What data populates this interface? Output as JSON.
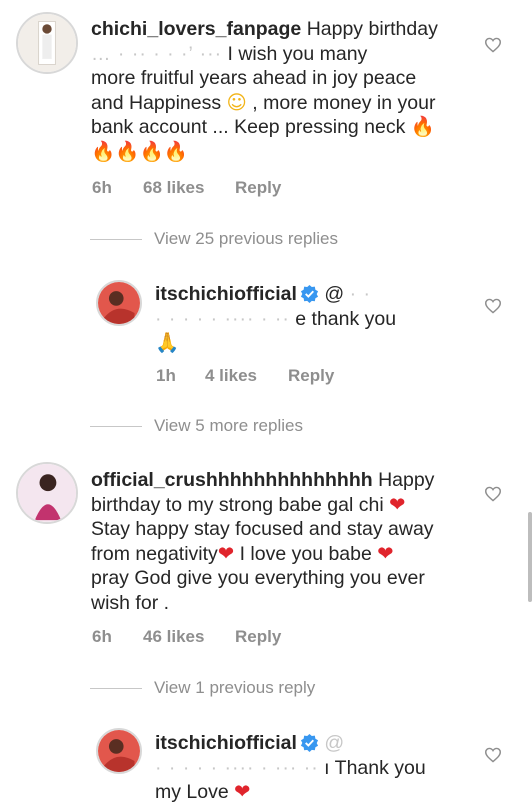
{
  "comments": [
    {
      "username": "chichi_lovers_fanpage",
      "line1_text": "Happy birthday",
      "line2_blur": "… · ··  · · ·’ ···",
      "line2_text": "I wish you many",
      "line3": "more fruitful years ahead in joy peace",
      "line4_text": "and Happiness",
      "line4_emoji": "☺",
      "line4_rest": ", more money in your",
      "line5_text": "bank account ... Keep pressing neck",
      "fire_emoji": "🔥",
      "time": "6h",
      "likes": "68 likes",
      "reply": "Reply"
    },
    {
      "username": "official_crushhhhhhhhhhhhhh",
      "line1_text": "Happy",
      "line2": "birthday to my strong babe gal chi",
      "line3": "Stay happy stay focused and stay away",
      "line4": "from negativity",
      "line4_rest": "I love you babe",
      "line5": "pray God give you everything you ever",
      "line6": "wish for .",
      "heart_emoji": "❤",
      "time": "6h",
      "likes": "46 likes",
      "reply": "Reply"
    }
  ],
  "replies": [
    {
      "username": "itschichiofficial",
      "mention": "@",
      "mention_blur": "·  ·",
      "line2_blur": "·   ·  · · ·  ···· · ··",
      "line2_text": "e thank you",
      "pray_emoji": "🙏",
      "time": "1h",
      "likes": "4 likes",
      "reply": "Reply"
    },
    {
      "username": "itschichiofficial",
      "mention": "@",
      "line2_blur": "·  · · · · ···· · ··· ··",
      "line2_text": "ı Thank you",
      "line3": "my Love"
    }
  ],
  "view_more": [
    "View 25 previous replies",
    "View 5 more replies",
    "View 1 previous reply"
  ],
  "colors": {
    "verified": "#3897f0",
    "muted": "#8e8e8e",
    "text": "#262626"
  }
}
